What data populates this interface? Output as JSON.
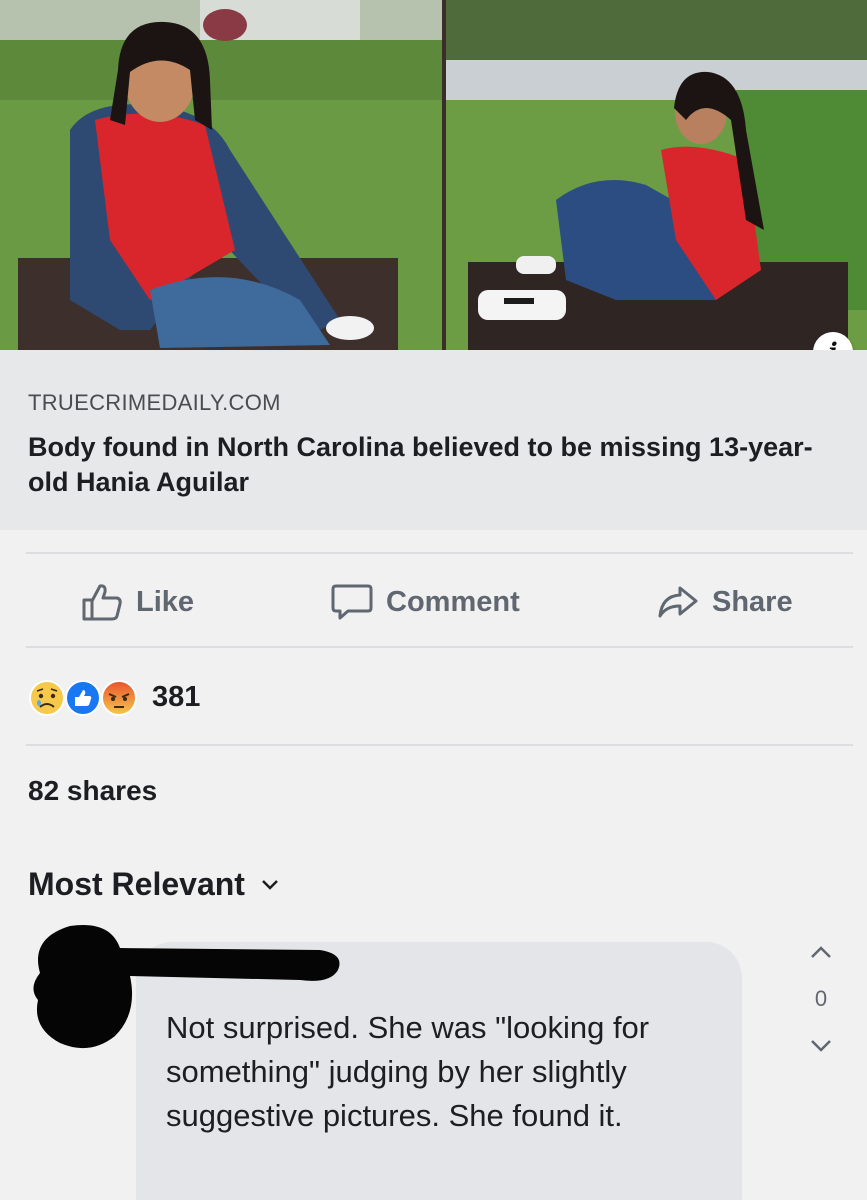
{
  "link_preview": {
    "domain": "TRUECRIMEDAILY.COM",
    "title": "Body found in North Carolina believed to be missing 13-year-old Hania Aguilar",
    "info_icon_glyph": "i",
    "images": [
      {
        "icon": "photo-girl-sitting-red-shirt-denim-jacket"
      },
      {
        "icon": "photo-girl-sitting-knees-up-red-top"
      }
    ]
  },
  "actions": {
    "like_label": "Like",
    "comment_label": "Comment",
    "share_label": "Share"
  },
  "reactions": {
    "icons": [
      "sad-reaction-icon",
      "like-reaction-icon",
      "angry-reaction-icon"
    ],
    "count": "381"
  },
  "shares_text": "82 shares",
  "sort_label": "Most Relevant",
  "comment": {
    "author_redacted": true,
    "text": "Not surprised. She was \"looking for something\" judging by her slightly suggestive pictures. She found it.",
    "vote_count": "0"
  },
  "colors": {
    "page_bg": "#f1f1f2",
    "caption_bg": "#e7e8ea",
    "bubble_bg": "#e4e5e8",
    "muted_text": "#606770",
    "like_blue": "#1877f2",
    "angry_orange": "#e8532f",
    "sad_yellow": "#f7c94b"
  }
}
